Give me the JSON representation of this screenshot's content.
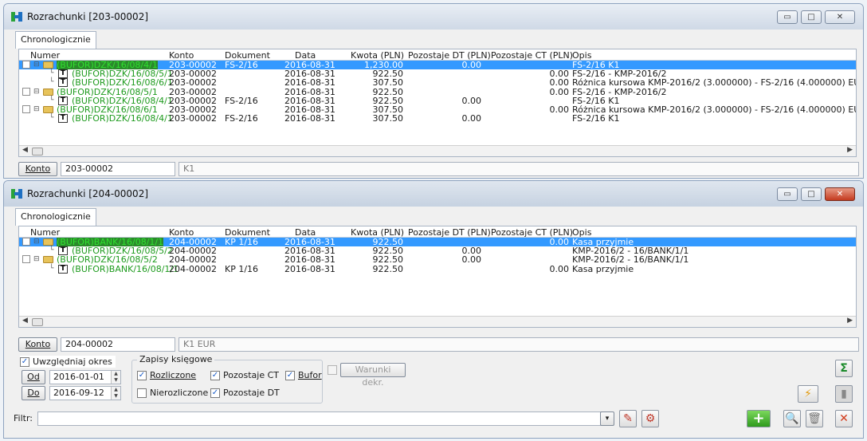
{
  "win1": {
    "title": "Rozrachunki [203-00002]",
    "tab": "Chronologicznie",
    "columns": [
      "Numer",
      "Konto",
      "Dokument",
      "Data",
      "Kwota (PLN)",
      "Pozostaje DT (PLN)",
      "Pozostaje CT (PLN)",
      "Opis"
    ],
    "rows": [
      {
        "numer": "(BUFOR)DZK/16/08/4/1",
        "konto": "203-00002",
        "dok": "FS-2/16",
        "data": "2016-08-31",
        "kwota": "1,230.00",
        "dt": "0.00",
        "ct": "",
        "opis": "FS-2/16 K1"
      },
      {
        "numer": "(BUFOR)DZK/16/08/5/1",
        "konto": "203-00002",
        "dok": "",
        "data": "2016-08-31",
        "kwota": "922.50",
        "dt": "",
        "ct": "0.00",
        "opis": "FS-2/16 - KMP-2016/2"
      },
      {
        "numer": "(BUFOR)DZK/16/08/6/1",
        "konto": "203-00002",
        "dok": "",
        "data": "2016-08-31",
        "kwota": "307.50",
        "dt": "",
        "ct": "0.00",
        "opis": "Różnica kursowa KMP-2016/2 (3.000000) - FS-2/16 (4.000000) EUR"
      },
      {
        "numer": "(BUFOR)DZK/16/08/5/1",
        "konto": "203-00002",
        "dok": "",
        "data": "2016-08-31",
        "kwota": "922.50",
        "dt": "",
        "ct": "0.00",
        "opis": "FS-2/16 - KMP-2016/2"
      },
      {
        "numer": "(BUFOR)DZK/16/08/4/1",
        "konto": "203-00002",
        "dok": "FS-2/16",
        "data": "2016-08-31",
        "kwota": "922.50",
        "dt": "0.00",
        "ct": "",
        "opis": "FS-2/16 K1"
      },
      {
        "numer": "(BUFOR)DZK/16/08/6/1",
        "konto": "203-00002",
        "dok": "",
        "data": "2016-08-31",
        "kwota": "307.50",
        "dt": "",
        "ct": "0.00",
        "opis": "Różnica kursowa KMP-2016/2 (3.000000) - FS-2/16 (4.000000) EUR"
      },
      {
        "numer": "(BUFOR)DZK/16/08/4/1",
        "konto": "203-00002",
        "dok": "FS-2/16",
        "data": "2016-08-31",
        "kwota": "307.50",
        "dt": "0.00",
        "ct": "",
        "opis": "FS-2/16 K1"
      }
    ],
    "konto_button": "Konto",
    "konto_value": "203-00002",
    "konto_name": "K1"
  },
  "win2": {
    "title": "Rozrachunki [204-00002]",
    "tab": "Chronologicznie",
    "columns": [
      "Numer",
      "Konto",
      "Dokument",
      "Data",
      "Kwota (PLN)",
      "Pozostaje DT (PLN)",
      "Pozostaje CT (PLN)",
      "Opis"
    ],
    "rows": [
      {
        "numer": "(BUFOR)BANK/16/08/1/1",
        "konto": "204-00002",
        "dok": "KP 1/16",
        "data": "2016-08-31",
        "kwota": "922.50",
        "dt": "",
        "ct": "0.00",
        "opis": "Kasa przyjmie"
      },
      {
        "numer": "(BUFOR)DZK/16/08/5/2",
        "konto": "204-00002",
        "dok": "",
        "data": "2016-08-31",
        "kwota": "922.50",
        "dt": "0.00",
        "ct": "",
        "opis": "KMP-2016/2 - 16/BANK/1/1"
      },
      {
        "numer": "(BUFOR)DZK/16/08/5/2",
        "konto": "204-00002",
        "dok": "",
        "data": "2016-08-31",
        "kwota": "922.50",
        "dt": "0.00",
        "ct": "",
        "opis": "KMP-2016/2 - 16/BANK/1/1"
      },
      {
        "numer": "(BUFOR)BANK/16/08/1/1",
        "konto": "204-00002",
        "dok": "KP 1/16",
        "data": "2016-08-31",
        "kwota": "922.50",
        "dt": "",
        "ct": "0.00",
        "opis": "Kasa przyjmie"
      }
    ],
    "konto_button": "Konto",
    "konto_value": "204-00002",
    "konto_name": "K1 EUR",
    "uwzgledniaj": "Uwzględniaj okres",
    "od_label": "Od",
    "od_value": "2016-01-01",
    "do_label": "Do",
    "do_value": "2016-09-12",
    "zapisy_label": "Zapisy księgowe",
    "rozliczone": "Rozliczone",
    "nierozliczone": "Nierozliczone",
    "pozostaje_ct": "Pozostaje CT",
    "pozostaje_dt": "Pozostaje DT",
    "bufor": "Bufor",
    "warunki": "Warunki dekr.",
    "filtr_label": "Filtr:",
    "filtr_value": ""
  },
  "controls": {
    "min": "▭",
    "max": "□",
    "close": "✕"
  },
  "icons": {
    "sigma": "Σ",
    "lightning": "⚡",
    "plus": "+",
    "search": "🔍",
    "trash": "🗑",
    "close_x": "✕",
    "dropdown": "▾"
  },
  "colors": {
    "accent": "#3399ff",
    "bufor_text": "#1e9b1e",
    "close_red": "#d23a1a"
  }
}
